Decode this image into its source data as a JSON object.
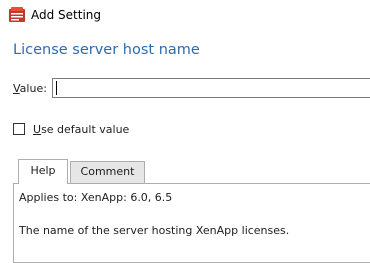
{
  "window": {
    "title": "Add Setting",
    "icon": "settings-app-icon"
  },
  "setting": {
    "name": "License server host name"
  },
  "value_field": {
    "label_accel": "V",
    "label_rest": "alue:",
    "value": ""
  },
  "use_default": {
    "label_accel": "U",
    "label_rest": "se default value",
    "checked": false
  },
  "tabs": [
    {
      "label": "Help",
      "selected": true
    },
    {
      "label": "Comment",
      "selected": false
    }
  ],
  "help": {
    "applies_to": "Applies to: XenApp: 6.0, 6.5",
    "description": "The name of the server hosting XenApp licenses."
  }
}
